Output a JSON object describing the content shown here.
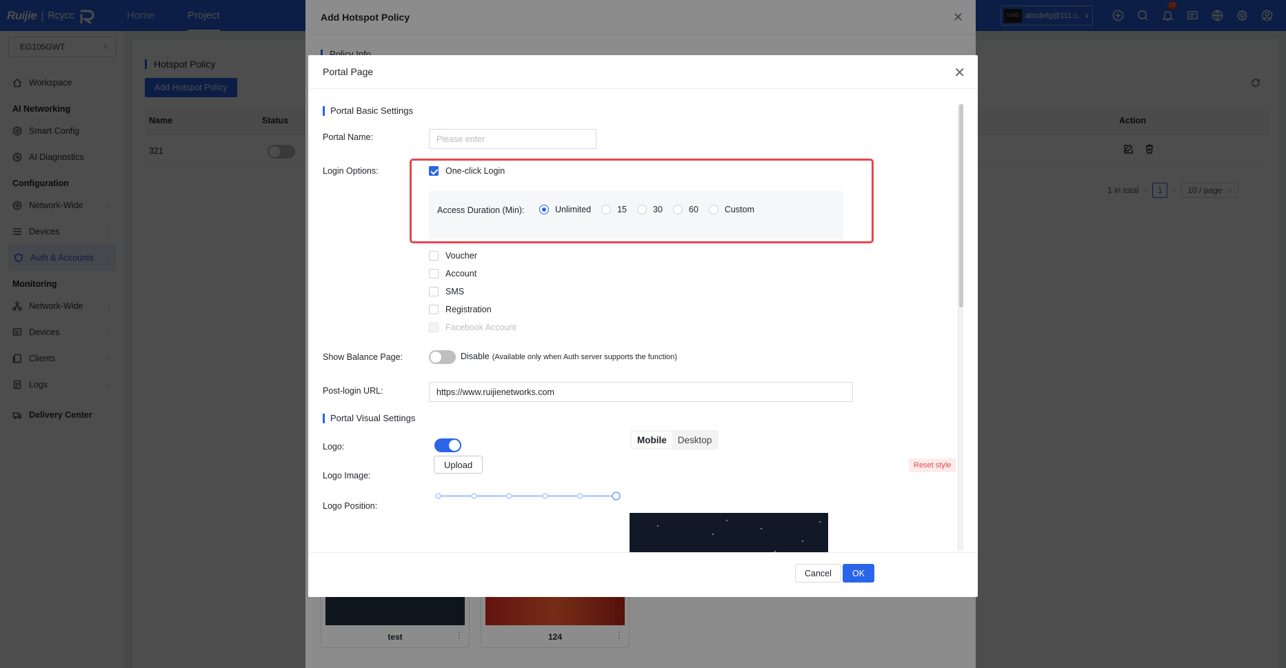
{
  "topbar": {
    "brand_left": "Ruijie",
    "brand_sep": "|",
    "brand_right": "Rcycc",
    "tabs": [
      {
        "label": "Home"
      },
      {
        "label": "Project"
      }
    ],
    "account": "abcdefg@111.c...",
    "logo_chip": "LOGO",
    "notification_count": "13"
  },
  "sidebar": {
    "site": "EG105GWT",
    "workspace": "Workspace",
    "groups": {
      "ai": "AI Networking",
      "config": "Configuration",
      "monitoring": "Monitoring"
    },
    "items": {
      "smart_config": "Smart Config",
      "ai_diagnostics": "AI Diagnostics",
      "network_wide": "Network-Wide",
      "devices": "Devices",
      "auth_accounts": "Auth & Accounts",
      "mon_network_wide": "Network-Wide",
      "mon_devices": "Devices",
      "clients": "Clients",
      "logs": "Logs"
    },
    "delivery_center": "Delivery Center"
  },
  "page": {
    "title": "Hotspot Policy",
    "add_button": "Add Hotspot Policy",
    "columns": {
      "name": "Name",
      "status": "Status",
      "action": "Action"
    },
    "rows": [
      {
        "name": "321"
      }
    ],
    "pager": {
      "total": "1 in total",
      "current": "1",
      "size": "10 / page"
    }
  },
  "outer_modal": {
    "title": "Add Hotspot Policy",
    "section": "Policy Info",
    "templates": [
      {
        "name": "test"
      },
      {
        "name": "124"
      }
    ]
  },
  "modal": {
    "title": "Portal Page",
    "basic_section": "Portal Basic Settings",
    "portal_name_label": "Portal Name:",
    "portal_name_placeholder": "Please enter",
    "login_options_label": "Login Options:",
    "login_options": {
      "one_click": "One-click Login",
      "voucher": "Voucher",
      "account": "Account",
      "sms": "SMS",
      "registration": "Registration",
      "facebook": "Facebook Account"
    },
    "access_duration_label": "Access Duration (Min):",
    "durations": [
      "Unlimited",
      "15",
      "30",
      "60",
      "Custom"
    ],
    "balance_label": "Show Balance Page:",
    "balance_state": "Disable",
    "balance_note": "(Available only when Auth server supports the function)",
    "post_login_label": "Post-login URL:",
    "post_login_value": "https://www.ruijienetworks.com",
    "visual_section": "Portal Visual Settings",
    "logo_label": "Logo:",
    "logo_image_label": "Logo Image:",
    "upload_label": "Upload",
    "logo_position_label": "Logo Position:",
    "logo_position_steps": 6,
    "logo_position_selected": 6,
    "view_tabs": [
      "Mobile",
      "Desktop"
    ],
    "reset_style": "Reset style",
    "cancel": "Cancel",
    "ok": "OK"
  },
  "colors": {
    "primary": "#2a64e8",
    "highlight": "#e5484d"
  }
}
